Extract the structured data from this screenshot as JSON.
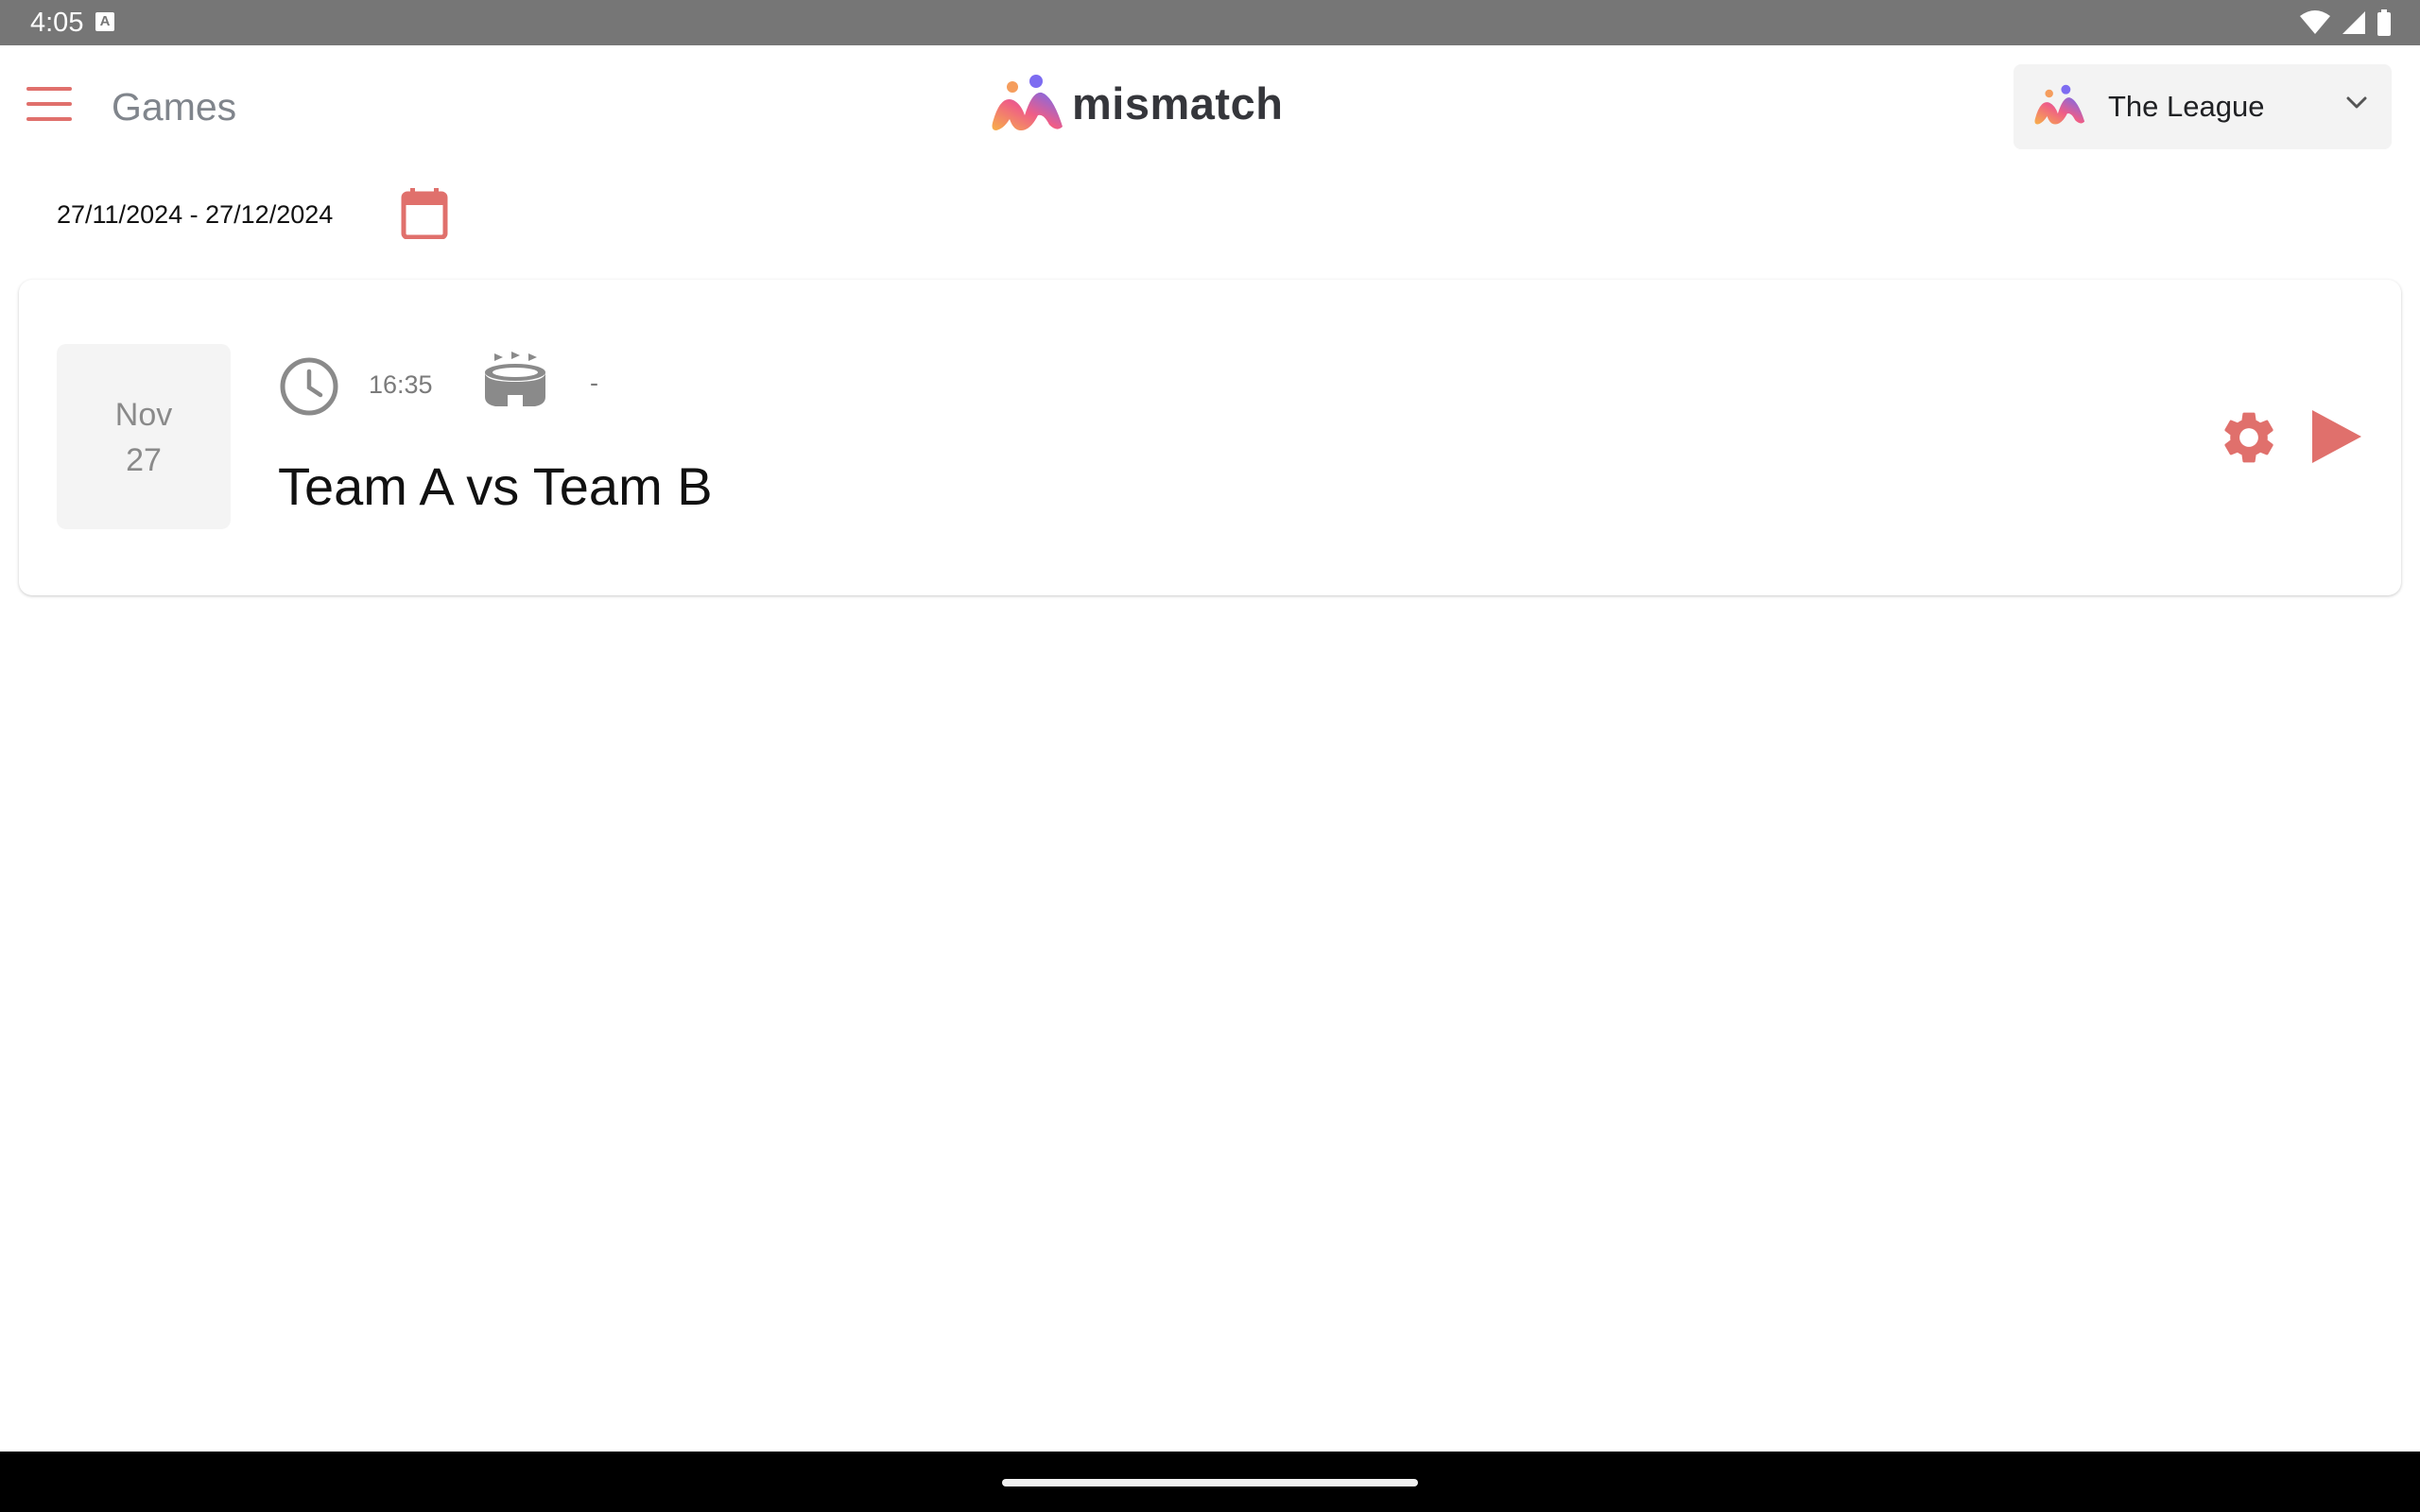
{
  "status_bar": {
    "time": "4:05",
    "notification_icon": "a-icon"
  },
  "header": {
    "menu_icon": "hamburger-menu-icon",
    "title": "Games",
    "brand_name": "mismatch"
  },
  "league_selector": {
    "selected": "The League"
  },
  "filters": {
    "date_range": "27/11/2024 - 27/12/2024",
    "calendar_icon": "calendar-icon"
  },
  "games": [
    {
      "month": "Nov",
      "day": "27",
      "time": "16:35",
      "venue": "-",
      "matchup": "Team A vs Team B"
    }
  ],
  "colors": {
    "accent": "#e0706c",
    "status_bar": "#767676",
    "muted_text": "#7b7b7b",
    "date_box_bg": "#f4f4f4"
  }
}
